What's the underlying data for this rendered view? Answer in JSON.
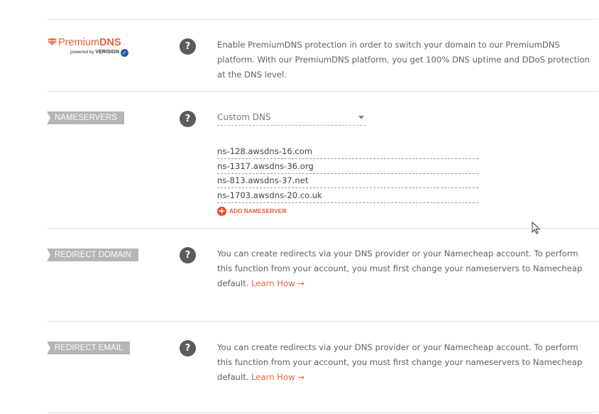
{
  "premium_dns": {
    "logo_text_normal": "Premium",
    "logo_text_bold": "DNS",
    "powered_by": "powered by",
    "verisign": "VERISIGN",
    "help": "?",
    "description": "Enable PremiumDNS protection in order to switch your domain to our PremiumDNS platform. With our PremiumDNS platform, you get 100% DNS uptime and DDoS protection at the DNS level."
  },
  "nameservers": {
    "label": "NAMESERVERS",
    "help": "?",
    "selected": "Custom DNS",
    "servers": [
      "ns-128.awsdns-16.com",
      "ns-1317.awsdns-36.org",
      "ns-813.awsdns-37.net",
      "ns-1703.awsdns-20.co.uk"
    ],
    "add_label": "ADD NAMESERVER"
  },
  "redirect_domain": {
    "label": "REDIRECT DOMAIN",
    "help": "?",
    "description": "You can create redirects via your DNS provider or your Namecheap account. To perform this function from your account, you must first change your nameservers to Namecheap default.",
    "learn_how": "Learn How →"
  },
  "redirect_email": {
    "label": "REDIRECT EMAIL",
    "help": "?",
    "description": "You can create redirects via your DNS provider or your Namecheap account. To perform this function from your account, you must first change your nameservers to Namecheap default.",
    "learn_how": "Learn How →"
  },
  "colors": {
    "accent": "#e3623b",
    "tag_bg": "#b5b5b5",
    "help_bg": "#5b5b5b",
    "verisign_blue": "#1f5d9e"
  }
}
